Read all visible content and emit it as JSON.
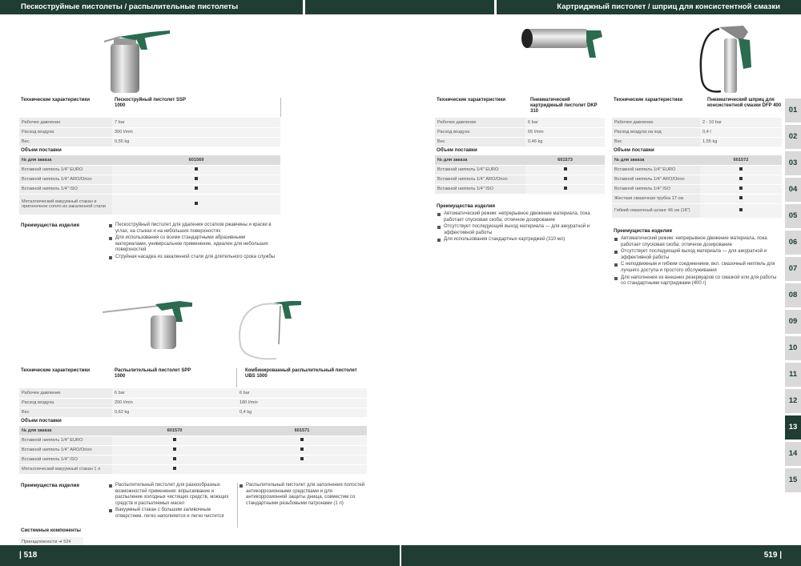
{
  "header": {
    "left": "Пескоструйные пистолеты / распылительные пистолеты",
    "right": "Картриджный пистолет / шприц для консистентной смазки"
  },
  "footer": {
    "left": "| 518",
    "right": "519 |"
  },
  "labels": {
    "tech": "Технические характеристики",
    "supply": "Объем поставки",
    "order": "№ для заказа",
    "benefits": "Преимущества изделия",
    "system": "Системные компоненты",
    "accessories": "Принадлежности ➜ 524"
  },
  "ssp": {
    "name": "Пескоструйный пистолет SSP 1000",
    "rows": [
      [
        "Рабочее давление",
        "7 bar"
      ],
      [
        "Расход воздуха",
        "300 l/min"
      ],
      [
        "Вес",
        "0,55 kg"
      ]
    ],
    "order": "601569",
    "supply": [
      "Вставной ниппель 1/4\" EURO",
      "Вставной ниппель 1/4\" ARO/Orion",
      "Вставной ниппель 1/4\" ISO",
      "Металлический вакуумный стакан и пригоночное сопло из закаленной стали"
    ],
    "benefits": [
      "Пескоструйный пистолет для удаления остатков ржавчины и краски в углах, на стыках и на небольших поверхностях",
      "Для использования со всеми стандартными абразивными материалами, универсальное применение, идеален для небольших поверхностей",
      "Струйная насадка из закаленной стали для длительного срока службы"
    ]
  },
  "spp": {
    "name": "Распылительный пистолет SPP 1000",
    "rows": [
      "6 bar",
      "200 l/min",
      "0,62 kg"
    ],
    "order": "601570",
    "benefit": "Распылительный пистолет для разнообразных возможностей применения: впрыскивание и распыление холодных чистящих средств, моющих средств и распыляемых масел",
    "benefit2": "Вакуумный стакан с большим заливочным отверстием, легко наполняется и легко чистится"
  },
  "ubs": {
    "name": "Комбинированный распылительный пистолет UBS 1000",
    "rows": [
      "6 bar",
      "180 l/min",
      "0,4 kg"
    ],
    "order": "601571",
    "benefit": "Распылительный пистолет для заполнения полостей антикоррозионными средствами и для антикоррозионной защиты днища, совместим со стандартными резьбовыми патронами (1 л)"
  },
  "spp_rows": [
    "Рабочее давление",
    "Расход воздуха",
    "Вес"
  ],
  "spp_supply": [
    "Вставной ниппель 1/4\" EURO",
    "Вставной ниппель 1/4\" ARO/Orion",
    "Вставной ниппель 1/4\" ISO",
    "Металлический вакуумный стакан 1 л"
  ],
  "dkp": {
    "name": "Пневматический картриджный пистолет DKP 310",
    "rows": [
      [
        "Рабочее давление",
        "6 bar"
      ],
      [
        "Расход воздуха",
        "65 l/min"
      ],
      [
        "Вес",
        "0,46 kg"
      ]
    ],
    "order": "601573",
    "supply": [
      "Вставной ниппель 1/4\" EURO",
      "Вставной ниппель 1/4\" ARO/Orion",
      "Вставной ниппель 1/4\" ISO"
    ],
    "benefits": [
      "Автоматический режим: непрерывное движение материала, пока работает спусковая скоба; отличное дозирование",
      "Отсутствует последующий выход материала — для аккуратной и эффективной работы",
      "Для использования стандартных картриджей (310 мл)"
    ]
  },
  "dfp": {
    "name": "Пневматический шприц для консистентной смазки DFP 400",
    "rows": [
      [
        "Рабочее давление",
        "2 - 10 bar"
      ],
      [
        "Расход воздуха на ход",
        "0,4 l"
      ],
      [
        "Вес",
        "1,55 kg"
      ]
    ],
    "order": "601572",
    "supply": [
      "Вставной ниппель 1/4\" EURO",
      "Вставной ниппель 1/4\" ARO/Orion",
      "Вставной ниппель 1/4\" ISO",
      "Жесткая смазочная трубка 17 см",
      "Гибкий смазочный шланг 46 см (18\")"
    ],
    "benefits": [
      "Автоматический режим: непрерывное движение материала, пока работает спусковая скоба; отличное дозирование",
      "Отсутствует последующий выход материала — для аккуратной и эффективной работы",
      "С неподвижным и гибким соединением, вкл. смазочный ниппель для лучшего доступа и простого обслуживания",
      "Для наполнения из внешних резервуаров со смазкой или для работы со стандартными картриджами (400 г)"
    ]
  },
  "tabs": [
    "01",
    "02",
    "03",
    "04",
    "05",
    "06",
    "07",
    "08",
    "09",
    "10",
    "11",
    "12",
    "13",
    "14",
    "15"
  ],
  "active_tab": "13",
  "colors": {
    "brand": "#1f3d33",
    "tab": "#d9d9d9"
  }
}
